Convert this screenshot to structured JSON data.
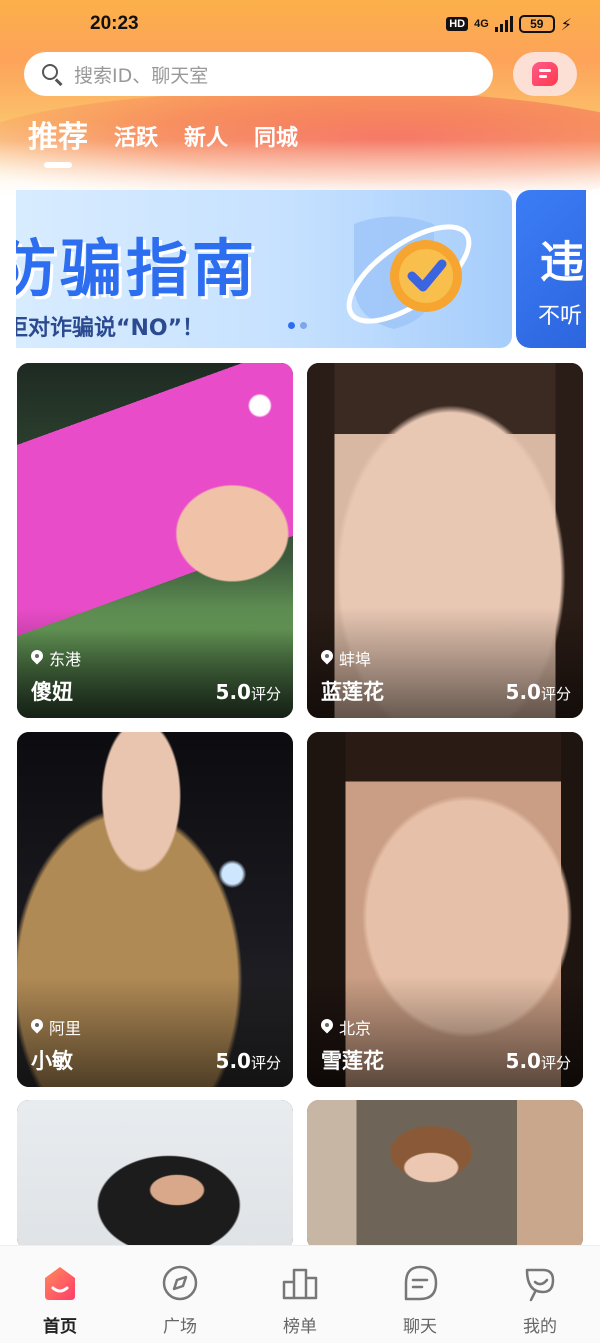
{
  "status_bar": {
    "time": "20:23",
    "hd": "HD",
    "network": "4G",
    "battery": "59"
  },
  "search": {
    "placeholder": "搜索ID、聊天室"
  },
  "header": {
    "message_icon": "chat-bubble-icon"
  },
  "tabs": [
    {
      "label": "推荐",
      "active": true
    },
    {
      "label": "活跃",
      "active": false
    },
    {
      "label": "新人",
      "active": false
    },
    {
      "label": "同城",
      "active": false
    }
  ],
  "banner": {
    "headline": "防骗指南",
    "subline": "拒对诈骗说“NO”！",
    "next_title": "违",
    "next_subtitle": "不听"
  },
  "cards": [
    {
      "location": "东港",
      "name": "傻妞",
      "rating": "5.0",
      "rating_unit": "评分"
    },
    {
      "location": "蚌埠",
      "name": "蓝莲花",
      "rating": "5.0",
      "rating_unit": "评分"
    },
    {
      "location": "阿里",
      "name": "小敏",
      "rating": "5.0",
      "rating_unit": "评分"
    },
    {
      "location": "北京",
      "name": "雪莲花",
      "rating": "5.0",
      "rating_unit": "评分"
    }
  ],
  "bottom_nav": [
    {
      "label": "首页",
      "icon": "home-icon",
      "active": true
    },
    {
      "label": "广场",
      "icon": "compass-icon",
      "active": false
    },
    {
      "label": "榜单",
      "icon": "podium-icon",
      "active": false
    },
    {
      "label": "聊天",
      "icon": "chat-icon",
      "active": false
    },
    {
      "label": "我的",
      "icon": "profile-icon",
      "active": false
    }
  ],
  "colors": {
    "accent": "#ff4d5e",
    "header_orange": "#fcb04a",
    "banner_blue": "#2d6ef0"
  }
}
